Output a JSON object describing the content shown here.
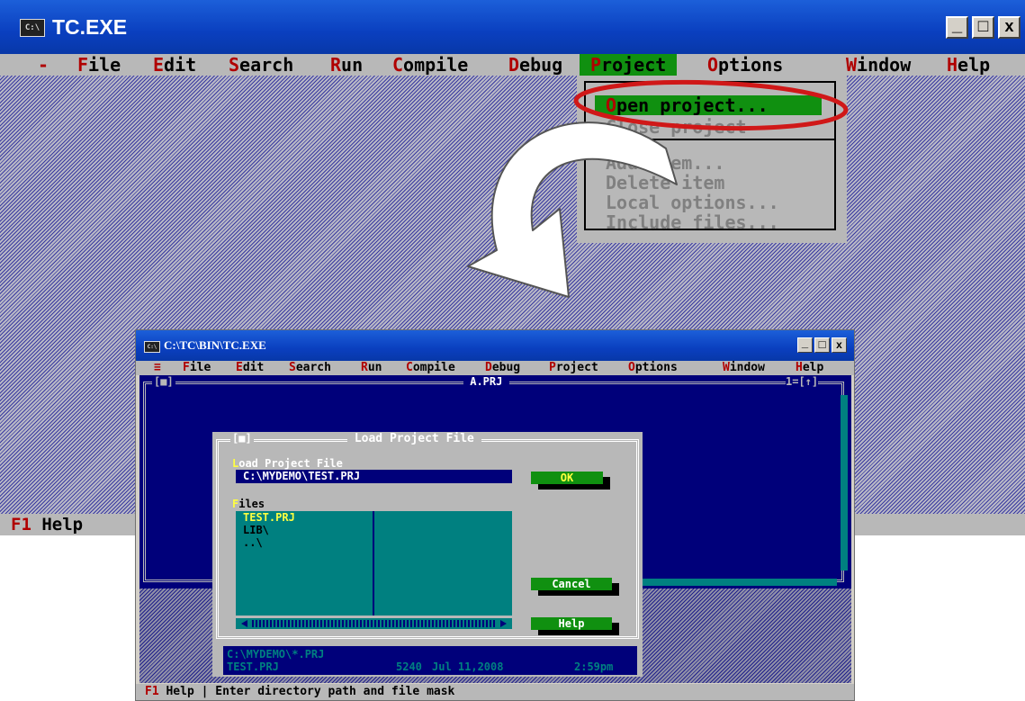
{
  "back": {
    "title": "TC.EXE",
    "sys_icon": "C:\\",
    "controls": [
      "_",
      "□",
      "x"
    ],
    "menu": [
      {
        "hot": "-",
        "rest": ""
      },
      {
        "hot": "F",
        "rest": "ile"
      },
      {
        "hot": "E",
        "rest": "dit"
      },
      {
        "hot": "S",
        "rest": "earch"
      },
      {
        "hot": "R",
        "rest": "un"
      },
      {
        "hot": "C",
        "rest": "ompile"
      },
      {
        "hot": "D",
        "rest": "ebug"
      },
      {
        "hot": "P",
        "rest": "roject"
      },
      {
        "hot": "O",
        "rest": "ptions"
      },
      {
        "hot": "W",
        "rest": "indow"
      },
      {
        "hot": "H",
        "rest": "elp"
      }
    ],
    "project_menu": {
      "selected": {
        "hot": "O",
        "rest": "pen project..."
      },
      "items": [
        "Close project",
        "Add item...",
        "Delete item",
        "Local options...",
        "Include files..."
      ]
    },
    "status": {
      "key": "F1",
      "text": " Help"
    }
  },
  "front": {
    "title": "C:\\TC\\BIN\\TC.EXE",
    "sys_icon": "C:\\",
    "controls": [
      "_",
      "□",
      "x"
    ],
    "menu": [
      {
        "hot": "≡",
        "rest": ""
      },
      {
        "hot": "F",
        "rest": "ile"
      },
      {
        "hot": "E",
        "rest": "dit"
      },
      {
        "hot": "S",
        "rest": "earch"
      },
      {
        "hot": "R",
        "rest": "un"
      },
      {
        "hot": "C",
        "rest": "ompile"
      },
      {
        "hot": "D",
        "rest": "ebug"
      },
      {
        "hot": "P",
        "rest": "roject"
      },
      {
        "hot": "O",
        "rest": "ptions"
      },
      {
        "hot": "W",
        "rest": "indow"
      },
      {
        "hot": "H",
        "rest": "elp"
      }
    ],
    "editor": {
      "left_marker": "[■]",
      "title": " A.PRJ ",
      "right_marker": "1=[↑]"
    },
    "dialog": {
      "title": " Load Project File ",
      "close_marker": "[■]",
      "field_label_hot": "L",
      "field_label_rest": "oad Project File",
      "field_value": "C:\\MYDEMO\\TEST.PRJ",
      "files_label_hot": "F",
      "files_label_rest": "iles",
      "files": [
        "TEST.PRJ",
        "LIB\\",
        "..\\"
      ],
      "ok": "OK",
      "cancel": "Cancel",
      "help": "Help",
      "info_path": "C:\\MYDEMO\\*.PRJ",
      "info_file": "TEST.PRJ",
      "info_size": "5240",
      "info_date": "Jul 11,2008",
      "info_time": "2:59pm"
    },
    "status": {
      "key": "F1",
      "text": " Help | Enter directory path and file mask"
    }
  },
  "colors": {
    "menu_bg": "#b8b8b8",
    "highlight": "#109010",
    "hot_red": "#b00000",
    "editor_blue": "#00007a",
    "dialog_gray": "#b8b8b8",
    "list_teal": "#008080",
    "annotation": "#d01818"
  }
}
